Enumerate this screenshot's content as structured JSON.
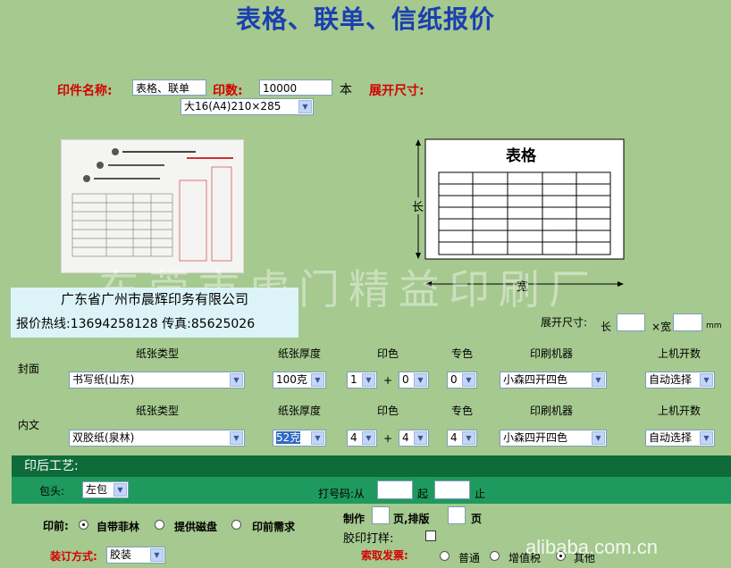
{
  "title": "表格、联单、信纸报价",
  "top": {
    "name_label": "印件名称:",
    "name_value": "表格、联单",
    "qty_label": "印数:",
    "qty_value": "10000",
    "qty_unit": "本",
    "size_label": "展开尺寸:",
    "size_select": "大16(A4)210×285"
  },
  "diagram": {
    "heading": "表格",
    "length_label": "长",
    "width_label": "宽"
  },
  "watermark": "东莞市虎门精益印刷厂",
  "company": {
    "name": "广东省广州市晨辉印务有限公司",
    "hotline": "报价热线:13694258128 传真:85625026"
  },
  "custom_size": {
    "label": "展开尺寸:",
    "length": "长",
    "times": "×宽",
    "unit": "mm"
  },
  "columns": {
    "paper_type": "纸张类型",
    "thickness": "纸张厚度",
    "colors": "印色",
    "spot": "专色",
    "machine": "印刷机器",
    "sheets": "上机开数"
  },
  "cover": {
    "label": "封面",
    "paper": "书写纸(山东)",
    "thickness": "100克",
    "color1": "1",
    "plus": "+",
    "color2": "0",
    "spot": "0",
    "machine": "小森四开四色",
    "sheets": "自动选择"
  },
  "inner": {
    "label": "内文",
    "paper": "双胶纸(泉林)",
    "thickness": "52克",
    "color1": "4",
    "plus": "+",
    "color2": "4",
    "spot": "4",
    "machine": "小森四开四色",
    "sheets": "自动选择"
  },
  "post": {
    "title": "印后工艺:",
    "wrap_label": "包头:",
    "wrap_value": "左包",
    "number_label": "打号码:从",
    "number_from": "起",
    "number_to": "止"
  },
  "prepress": {
    "label": "印前:",
    "opt1": "自带菲林",
    "opt2": "提供磁盘",
    "opt3": "印前需求",
    "make_label": "制作",
    "make_unit": "页,排版",
    "layout_unit": "页",
    "proof_label": "胶印打样:"
  },
  "binding": {
    "label": "装订方式:",
    "value": "胶装"
  },
  "invoice": {
    "label": "索取发票:",
    "opt1": "普通",
    "opt2": "增值税",
    "opt3": "其他"
  },
  "footer_watermark": "alibaba.com.cn",
  "colors": {
    "background": "#a5c98f",
    "title": "#1a3fb0",
    "label_red": "#d40000",
    "bar_dark": "#0e6b3a",
    "bar_green": "#1f9a5e"
  }
}
